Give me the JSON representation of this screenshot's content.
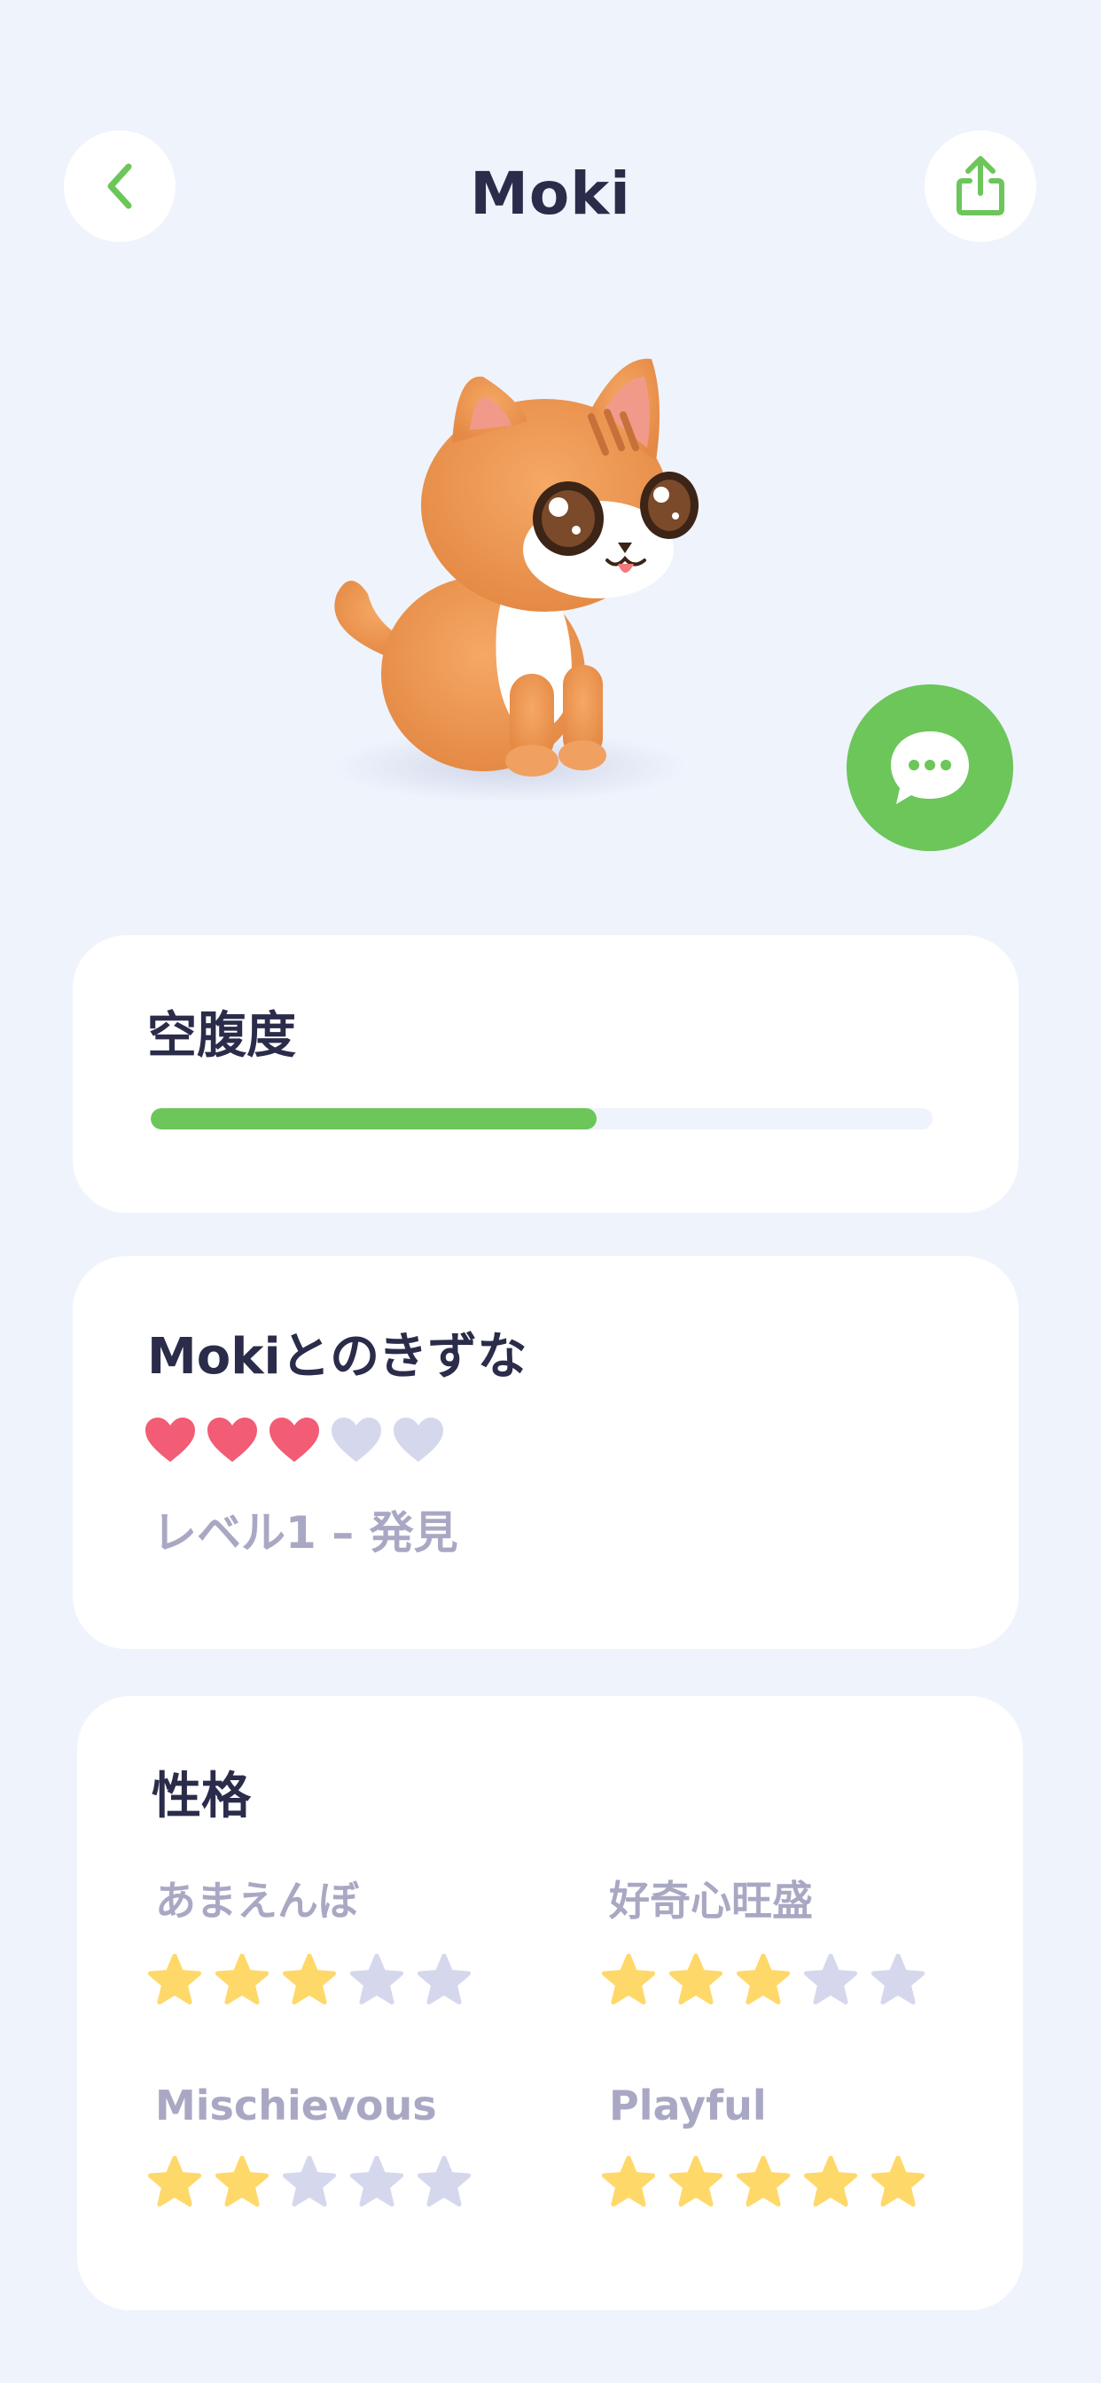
{
  "header": {
    "title": "Moki",
    "back_icon": "chevron-left-icon",
    "share_icon": "share-icon"
  },
  "colors": {
    "accent_green": "#6cc65a",
    "heart_filled": "#f25c74",
    "heart_empty": "#d5d8ed",
    "star_filled": "#ffd86a",
    "star_empty": "#d5d8ed"
  },
  "hunger": {
    "title": "空腹度",
    "level": 0.57
  },
  "bond": {
    "title": "Mokiとのきずな",
    "hearts_total": 5,
    "hearts_filled": 3,
    "level_text": "レベル1 – 発見"
  },
  "personality": {
    "title": "性格",
    "traits": [
      {
        "label": "あまえんぼ",
        "rating": 3,
        "max": 5
      },
      {
        "label": "好奇心旺盛",
        "rating": 3,
        "max": 5
      },
      {
        "label": "Mischievous",
        "rating": 2,
        "max": 5
      },
      {
        "label": "Playful",
        "rating": 5,
        "max": 5
      }
    ]
  },
  "chat": {
    "icon": "chat-bubble-icon"
  }
}
